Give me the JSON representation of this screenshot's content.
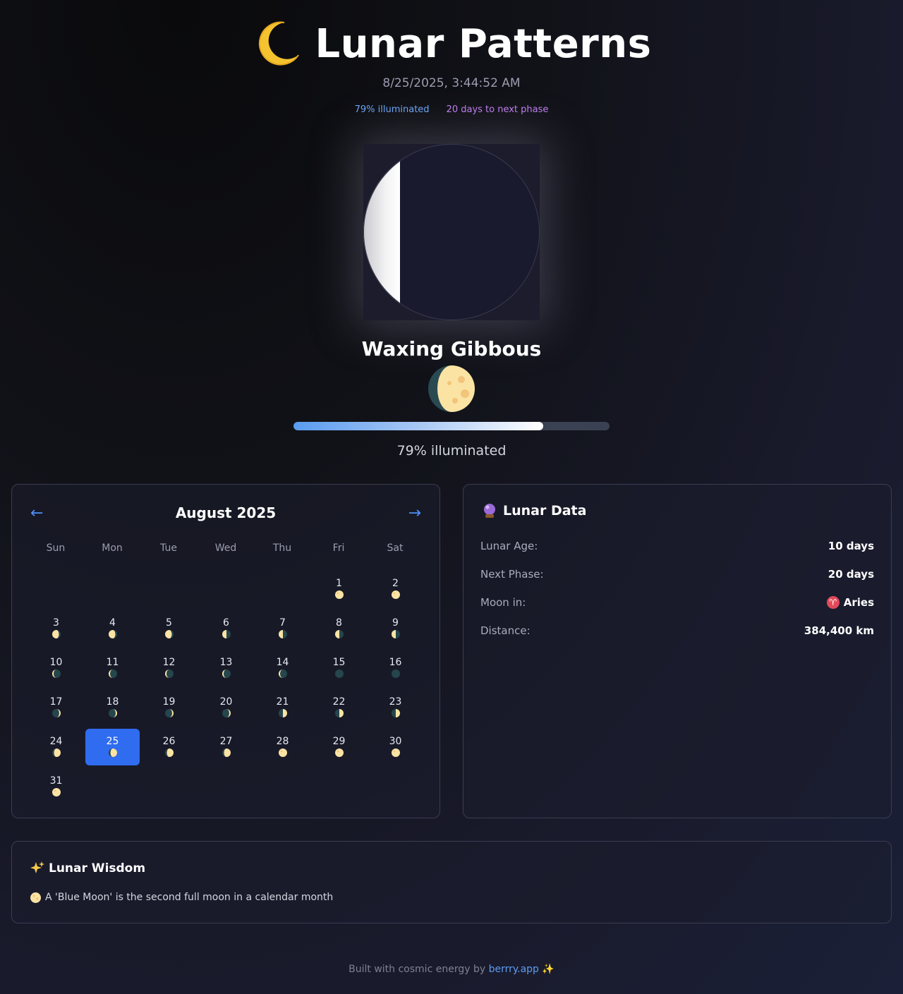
{
  "header": {
    "title": "Lunar Patterns",
    "title_icon": "crescent-moon-icon",
    "datetime": "8/25/2025, 3:44:52 AM",
    "illuminated_pill": "79% illuminated",
    "next_phase_pill": "20 days to next phase"
  },
  "moon": {
    "phase_name": "Waxing Gibbous",
    "phase_icon": "waxing-gibbous-moon-icon",
    "illumination": 0.79,
    "illumination_text": "79% illuminated"
  },
  "calendar": {
    "month_title": "August 2025",
    "prev_label": "←",
    "next_label": "→",
    "weekdays": [
      "Sun",
      "Mon",
      "Tue",
      "Wed",
      "Thu",
      "Fri",
      "Sat"
    ],
    "selected_day": 25,
    "days": [
      {
        "n": "1",
        "phase": "full"
      },
      {
        "n": "2",
        "phase": "full"
      },
      {
        "n": "3",
        "phase": "waning-gibbous"
      },
      {
        "n": "4",
        "phase": "waning-gibbous"
      },
      {
        "n": "5",
        "phase": "waning-gibbous"
      },
      {
        "n": "6",
        "phase": "last-quarter"
      },
      {
        "n": "7",
        "phase": "last-quarter"
      },
      {
        "n": "8",
        "phase": "last-quarter"
      },
      {
        "n": "9",
        "phase": "last-quarter"
      },
      {
        "n": "10",
        "phase": "waning-crescent"
      },
      {
        "n": "11",
        "phase": "waning-crescent"
      },
      {
        "n": "12",
        "phase": "waning-crescent"
      },
      {
        "n": "13",
        "phase": "waning-crescent"
      },
      {
        "n": "14",
        "phase": "waning-crescent"
      },
      {
        "n": "15",
        "phase": "new"
      },
      {
        "n": "16",
        "phase": "new"
      },
      {
        "n": "17",
        "phase": "waxing-crescent"
      },
      {
        "n": "18",
        "phase": "waxing-crescent"
      },
      {
        "n": "19",
        "phase": "waxing-crescent"
      },
      {
        "n": "20",
        "phase": "waxing-crescent"
      },
      {
        "n": "21",
        "phase": "first-quarter"
      },
      {
        "n": "22",
        "phase": "first-quarter"
      },
      {
        "n": "23",
        "phase": "first-quarter"
      },
      {
        "n": "24",
        "phase": "waxing-gibbous"
      },
      {
        "n": "25",
        "phase": "waxing-gibbous"
      },
      {
        "n": "26",
        "phase": "waxing-gibbous"
      },
      {
        "n": "27",
        "phase": "waxing-gibbous"
      },
      {
        "n": "28",
        "phase": "full"
      },
      {
        "n": "29",
        "phase": "full"
      },
      {
        "n": "30",
        "phase": "full"
      },
      {
        "n": "31",
        "phase": "full"
      }
    ]
  },
  "lunar_data": {
    "title": "Lunar Data",
    "title_icon": "crystal-ball-icon",
    "rows": [
      {
        "label": "Lunar Age:",
        "value": "10 days"
      },
      {
        "label": "Next Phase:",
        "value": "20 days"
      },
      {
        "label": "Moon in:",
        "value": "Aries",
        "icon": "aries-icon",
        "icon_glyph": "♈"
      },
      {
        "label": "Distance:",
        "value": "384,400 km"
      }
    ]
  },
  "wisdom": {
    "title": "Lunar Wisdom",
    "title_icon": "sparkles-icon",
    "fact": "A 'Blue Moon' is the second full moon in a calendar month",
    "fact_icon": "full-moon-icon"
  },
  "footer": {
    "prefix": "Built with cosmic energy by",
    "link": "berrry.app",
    "suffix_icon": "sparkles-icon"
  },
  "colors": {
    "accent_blue": "#2f6cf0",
    "link_blue": "#5d9cf2",
    "purple": "#c07ef0",
    "moon_yellow": "#fbe3a4"
  }
}
